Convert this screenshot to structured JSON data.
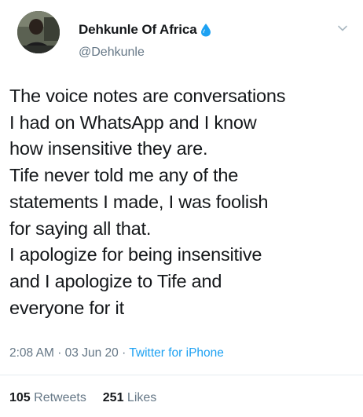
{
  "author": {
    "display_name": "Dehkunle Of Africa",
    "handle": "@Dehkunle",
    "badge_icon": "water-drop-icon",
    "badge_color": "#1da1f2"
  },
  "tweet": {
    "lines": [
      "The voice notes are conversations",
      "I had on WhatsApp and I know",
      "how insensitive they are.",
      "Tife never told me any of the",
      "statements I made, I was foolish",
      "for saying all that.",
      "I apologize for being insensitive",
      "and I apologize to Tife and",
      "everyone for it"
    ],
    "time": "2:08 AM",
    "date": "03 Jun 20",
    "separator": "·",
    "source": "Twitter for iPhone"
  },
  "stats": {
    "retweets_count": "105",
    "retweets_label": "Retweets",
    "likes_count": "251",
    "likes_label": "Likes"
  },
  "menu_icon": "chevron-down-icon",
  "colors": {
    "text": "#14171a",
    "secondary": "#657786",
    "link": "#1da1f2",
    "divider": "#e6ecf0"
  }
}
